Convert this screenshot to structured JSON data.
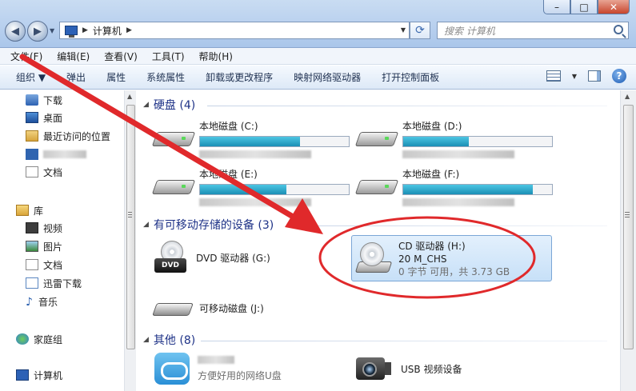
{
  "window": {
    "controls": [
      "minimize",
      "maximize",
      "close"
    ]
  },
  "address": {
    "path": "计算机",
    "search_placeholder": "搜索 计算机"
  },
  "menu": [
    "文件(F)",
    "编辑(E)",
    "查看(V)",
    "工具(T)",
    "帮助(H)"
  ],
  "toolbar": {
    "items": [
      "组织 ▼",
      "弹出",
      "属性",
      "系统属性",
      "卸载或更改程序",
      "映射网络驱动器",
      "打开控制面板"
    ]
  },
  "sidebar": {
    "items": [
      {
        "label": "下载",
        "icon": "download-folder-icon"
      },
      {
        "label": "桌面",
        "icon": "desktop-icon"
      },
      {
        "label": "最近访问的位置",
        "icon": "recent-places-icon"
      },
      {
        "label": "",
        "icon": "blurred-item-icon"
      },
      {
        "label": "文档",
        "icon": "document-icon"
      },
      {
        "label": "库",
        "icon": "library-icon"
      },
      {
        "label": "视频",
        "icon": "video-icon"
      },
      {
        "label": "图片",
        "icon": "pictures-icon"
      },
      {
        "label": "文档",
        "icon": "document-icon"
      },
      {
        "label": "迅雷下载",
        "icon": "xunlei-download-icon"
      },
      {
        "label": "音乐",
        "icon": "music-icon"
      },
      {
        "label": "家庭组",
        "icon": "homegroup-icon"
      },
      {
        "label": "计算机",
        "icon": "computer-icon"
      }
    ]
  },
  "groups": {
    "hdd": {
      "title": "硬盘 (4)"
    },
    "removable": {
      "title": "有可移动存储的设备 (3)"
    },
    "other": {
      "title": "其他 (8)"
    }
  },
  "drives": {
    "c": {
      "name": "本地磁盘 (C:)",
      "used_fraction": 0.67
    },
    "d": {
      "name": "本地磁盘 (D:)",
      "used_fraction": 0.44
    },
    "e": {
      "name": "本地磁盘 (E:)",
      "used_fraction": 0.58
    },
    "f": {
      "name": "本地磁盘 (F:)",
      "used_fraction": 0.87
    }
  },
  "devices": {
    "dvd": {
      "name": "DVD 驱动器 (G:)"
    },
    "cd": {
      "name": "CD 驱动器 (H:)",
      "label": "20 M_CHS",
      "space": "0 字节 可用，共 3.73 GB"
    },
    "usb": {
      "name": "可移动磁盘 (J:)"
    }
  },
  "others": {
    "netdisk": {
      "desc": "方便好用的网络U盘"
    },
    "webcam": {
      "name": "USB 视频设备"
    }
  },
  "colors": {
    "annotation": "#e0292b",
    "bar_fill": "#1b8fb5",
    "group_header": "#1e3287"
  }
}
